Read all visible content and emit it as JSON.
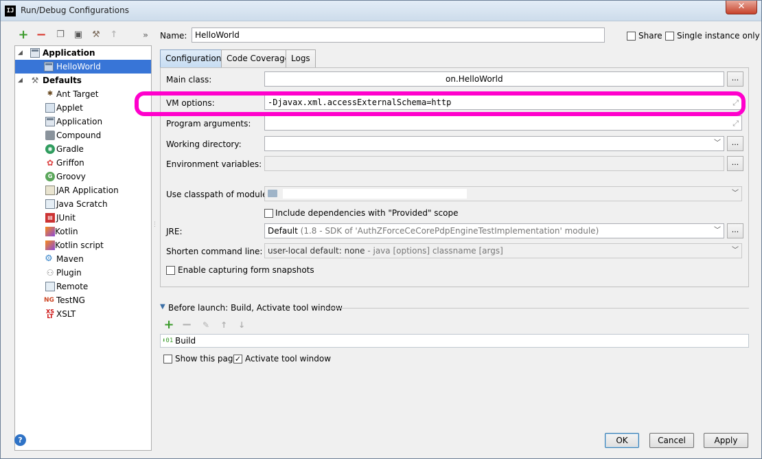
{
  "window": {
    "title": "Run/Debug Configurations",
    "app_icon_text": "IJ",
    "close_glyph": "✕"
  },
  "toolbar": {
    "add": "+",
    "remove": "−",
    "copy": "❐",
    "save": "▣",
    "edit": "⚒",
    "move_up": "↑",
    "more": "»"
  },
  "tree": {
    "application_group": "Application",
    "application_items": [
      "HelloWorld"
    ],
    "defaults_group": "Defaults",
    "defaults_items": [
      {
        "label": "Ant Target",
        "icon": "ant-icon"
      },
      {
        "label": "Applet",
        "icon": "applet-icon"
      },
      {
        "label": "Application",
        "icon": "application-icon"
      },
      {
        "label": "Compound",
        "icon": "compound-icon"
      },
      {
        "label": "Gradle",
        "icon": "gradle-icon"
      },
      {
        "label": "Griffon",
        "icon": "griffon-icon"
      },
      {
        "label": "Groovy",
        "icon": "groovy-icon"
      },
      {
        "label": "JAR Application",
        "icon": "jar-icon"
      },
      {
        "label": "Java Scratch",
        "icon": "java-scratch-icon"
      },
      {
        "label": "JUnit",
        "icon": "junit-icon"
      },
      {
        "label": "Kotlin",
        "icon": "kotlin-icon"
      },
      {
        "label": "Kotlin script",
        "icon": "kotlin-script-icon"
      },
      {
        "label": "Maven",
        "icon": "maven-icon"
      },
      {
        "label": "Plugin",
        "icon": "plugin-icon"
      },
      {
        "label": "Remote",
        "icon": "remote-icon"
      },
      {
        "label": "TestNG",
        "icon": "testng-icon"
      },
      {
        "label": "XSLT",
        "icon": "xslt-icon"
      }
    ]
  },
  "header": {
    "name_label": "Name:",
    "name_value": "HelloWorld",
    "share_label": "Share",
    "single_instance_label": "Single instance only"
  },
  "tabs": [
    "Configuration",
    "Code Coverage",
    "Logs"
  ],
  "config": {
    "main_class_label": "Main class:",
    "main_class_value": "on.HelloWorld",
    "vm_options_label": "VM options:",
    "vm_options_value": "-Djavax.xml.accessExternalSchema=http",
    "program_args_label": "Program arguments:",
    "program_args_value": "",
    "working_dir_label": "Working directory:",
    "working_dir_value": "",
    "env_vars_label": "Environment variables:",
    "env_vars_value": "",
    "classpath_label": "Use classpath of module:",
    "include_deps_label": "Include dependencies with \"Provided\" scope",
    "jre_label": "JRE:",
    "jre_value_main": "Default",
    "jre_value_detail": " (1.8 - SDK of 'AuthZForceCeCorePdpEngineTestImplementation' module)",
    "shorten_label": "Shorten command line:",
    "shorten_value_main": "user-local default: none",
    "shorten_value_detail": " - java [options] classname [args]",
    "snapshots_label": "Enable capturing form snapshots"
  },
  "before_launch": {
    "title": "Before launch: Build, Activate tool window",
    "item": "Build",
    "show_page_label": "Show this page",
    "activate_tool_label": "Activate tool window"
  },
  "buttons": {
    "ok": "OK",
    "cancel": "Cancel",
    "apply": "Apply",
    "help": "?"
  },
  "colors": {
    "highlight": "#ff00cc",
    "selection": "#3875d7"
  }
}
